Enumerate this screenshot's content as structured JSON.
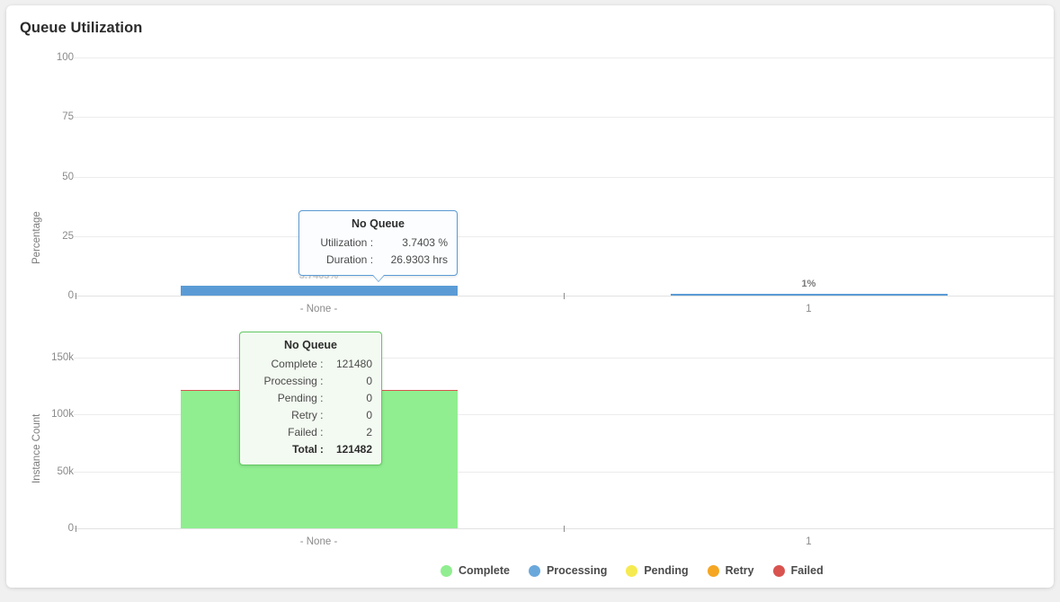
{
  "card": {
    "title": "Queue Utilization"
  },
  "chart_data": [
    {
      "type": "bar",
      "id": "utilization",
      "title": "Queue Utilization",
      "ylabel": "Percentage",
      "xlabel": "",
      "ylim": [
        0,
        100
      ],
      "yticks": [
        "0",
        "25",
        "50",
        "75",
        "100"
      ],
      "ytick_values": [
        0,
        25,
        50,
        75,
        100
      ],
      "categories": [
        "- None -",
        "1"
      ],
      "series": [
        {
          "name": "Utilization",
          "values": [
            3.7403,
            1
          ],
          "color": "#5b9bd5"
        }
      ],
      "data_labels": [
        "3.7403%",
        "1%"
      ],
      "grid": true,
      "orientation": "horizontal-bars"
    },
    {
      "type": "bar",
      "id": "instance-count",
      "title": "Instance Count",
      "ylabel": "Instance Count",
      "xlabel": "",
      "ylim": [
        0,
        150000
      ],
      "yticks": [
        "0",
        "50k",
        "100k",
        "150k"
      ],
      "ytick_values": [
        0,
        50000,
        100000,
        150000
      ],
      "categories": [
        "- None -",
        "1"
      ],
      "series": [
        {
          "name": "Complete",
          "values": [
            121480,
            0
          ],
          "color": "#90ee90"
        },
        {
          "name": "Processing",
          "values": [
            0,
            0
          ],
          "color": "#6aa8dc"
        },
        {
          "name": "Pending",
          "values": [
            0,
            0
          ],
          "color": "#f6ea51"
        },
        {
          "name": "Retry",
          "values": [
            0,
            0
          ],
          "color": "#f5a council"
        },
        {
          "name": "Failed",
          "values": [
            2,
            0
          ],
          "color": "#d9534f"
        }
      ],
      "grid": true
    }
  ],
  "tooltip_utilization": {
    "title": "No Queue",
    "rows": [
      {
        "key": "Utilization",
        "sep": ":",
        "value": "3.7403 %"
      },
      {
        "key": "Duration",
        "sep": ":",
        "value": "26.9303 hrs"
      }
    ],
    "border_color": "#5b9bd5"
  },
  "tooltip_instances": {
    "title": "No Queue",
    "rows": [
      {
        "key": "Complete",
        "sep": ":",
        "value": "121480",
        "total": false
      },
      {
        "key": "Processing",
        "sep": ":",
        "value": "0",
        "total": false
      },
      {
        "key": "Pending",
        "sep": ":",
        "value": "0",
        "total": false
      },
      {
        "key": "Retry",
        "sep": ":",
        "value": "0",
        "total": false
      },
      {
        "key": "Failed",
        "sep": ":",
        "value": "2",
        "total": false
      },
      {
        "key": "Total",
        "sep": ":",
        "value": "121482",
        "total": true
      }
    ],
    "border_color": "#63c963"
  },
  "legend": {
    "items": [
      {
        "label": "Complete",
        "color": "#90ee90"
      },
      {
        "label": "Processing",
        "color": "#6aa8dc"
      },
      {
        "label": "Pending",
        "color": "#f6ea51"
      },
      {
        "label": "Retry",
        "color": "#f5a623"
      },
      {
        "label": "Failed",
        "color": "#d9534f"
      }
    ]
  }
}
